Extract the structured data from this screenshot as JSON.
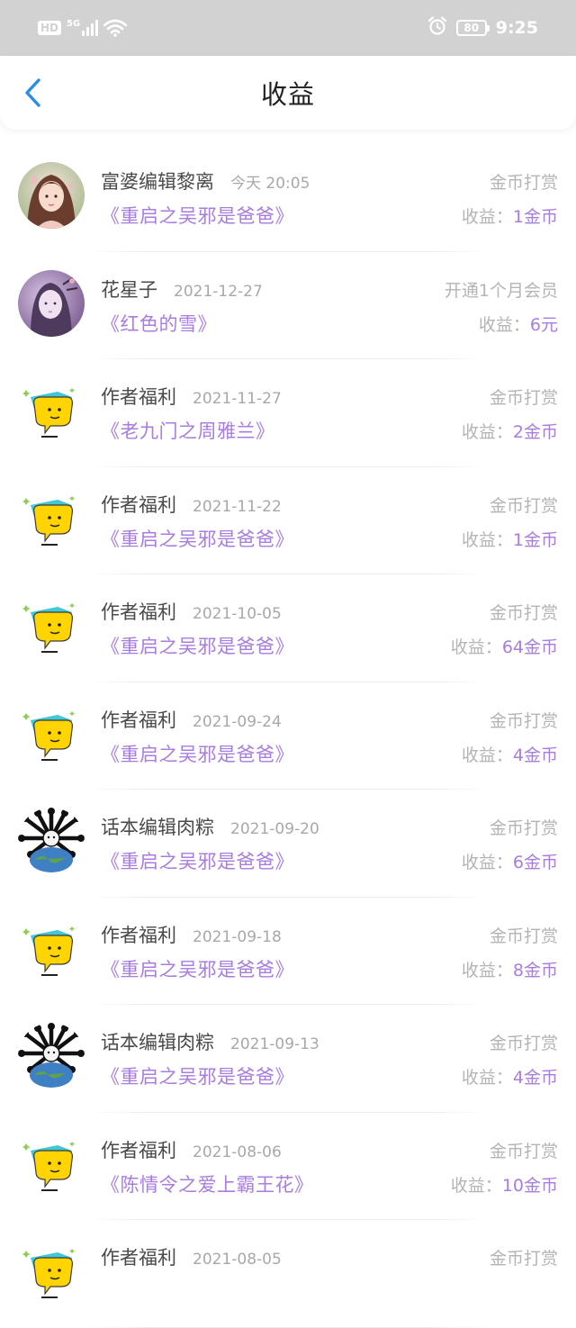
{
  "status_bar": {
    "hd_badge": "HD",
    "network": "5G",
    "battery_level": "80",
    "time": "9:25",
    "icons": [
      "signal-icon",
      "wifi-icon",
      "alarm-icon",
      "battery-icon"
    ]
  },
  "header": {
    "title": "收益",
    "back_icon": "chevron-left-icon",
    "accent_color": "#2b8de4"
  },
  "colors": {
    "purple": "#a97de0",
    "grey_text": "#b4b4b4",
    "name_text": "#4a4a4a"
  },
  "earnings": [
    {
      "sender": "富婆编辑黎离",
      "date": "今天 20:05",
      "type": "金币打赏",
      "book": "《重启之吴邪是爸爸》",
      "earn_label": "收益：",
      "earn_value": "1金币",
      "avatar": "girl-portrait-avatar"
    },
    {
      "sender": "花星子",
      "date": "2021-12-27",
      "type": "开通1个月会员",
      "book": "《红色的雪》",
      "earn_label": "收益：",
      "earn_value": "6元",
      "avatar": "purple-portrait-avatar"
    },
    {
      "sender": "作者福利",
      "date": "2021-11-27",
      "type": "金币打赏",
      "book": "《老九门之周雅兰》",
      "earn_label": "收益：",
      "earn_value": "2金币",
      "avatar": "yellow-chat-bubble-avatar"
    },
    {
      "sender": "作者福利",
      "date": "2021-11-22",
      "type": "金币打赏",
      "book": "《重启之吴邪是爸爸》",
      "earn_label": "收益：",
      "earn_value": "1金币",
      "avatar": "yellow-chat-bubble-avatar"
    },
    {
      "sender": "作者福利",
      "date": "2021-10-05",
      "type": "金币打赏",
      "book": "《重启之吴邪是爸爸》",
      "earn_label": "收益：",
      "earn_value": "64金币",
      "avatar": "yellow-chat-bubble-avatar"
    },
    {
      "sender": "作者福利",
      "date": "2021-09-24",
      "type": "金币打赏",
      "book": "《重启之吴邪是爸爸》",
      "earn_label": "收益：",
      "earn_value": "4金币",
      "avatar": "yellow-chat-bubble-avatar"
    },
    {
      "sender": "话本编辑肉粽",
      "date": "2021-09-20",
      "type": "金币打赏",
      "book": "《重启之吴邪是爸爸》",
      "earn_label": "收益：",
      "earn_value": "6金币",
      "avatar": "bear-globe-avatar"
    },
    {
      "sender": "作者福利",
      "date": "2021-09-18",
      "type": "金币打赏",
      "book": "《重启之吴邪是爸爸》",
      "earn_label": "收益：",
      "earn_value": "8金币",
      "avatar": "yellow-chat-bubble-avatar"
    },
    {
      "sender": "话本编辑肉粽",
      "date": "2021-09-13",
      "type": "金币打赏",
      "book": "《重启之吴邪是爸爸》",
      "earn_label": "收益：",
      "earn_value": "4金币",
      "avatar": "bear-globe-avatar"
    },
    {
      "sender": "作者福利",
      "date": "2021-08-06",
      "type": "金币打赏",
      "book": "《陈情令之爱上霸王花》",
      "earn_label": "收益：",
      "earn_value": "10金币",
      "avatar": "yellow-chat-bubble-avatar"
    },
    {
      "sender": "作者福利",
      "date": "2021-08-05",
      "type": "金币打赏",
      "book": "",
      "earn_label": "",
      "earn_value": "",
      "avatar": "yellow-chat-bubble-avatar"
    }
  ]
}
